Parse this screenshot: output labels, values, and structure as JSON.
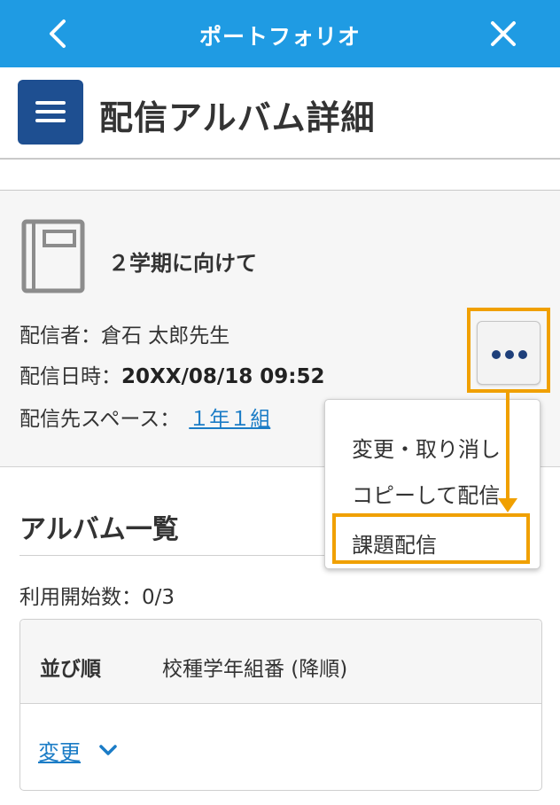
{
  "topbar": {
    "title": "ポートフォリオ",
    "back_icon": "chevron-left-icon",
    "close_icon": "close-icon",
    "color": "#1f9be3"
  },
  "header": {
    "menu_icon": "hamburger-menu-icon",
    "title": "配信アルバム詳細",
    "menu_color": "#1e4f91"
  },
  "album": {
    "icon": "book-icon",
    "title": "２学期に向けて",
    "sender_label": "配信者：",
    "sender_value": "倉石 太郎先生",
    "date_label": "配信日時：",
    "date_value": "20XX/08/18 09:52",
    "space_label": "配信先スペース：",
    "space_value": "１年１組"
  },
  "more_menu": {
    "button_icon": "more-dots-icon",
    "items": [
      "変更・取り消し",
      "コピーして配信",
      "課題配信"
    ],
    "highlighted_item": "課題配信",
    "highlight_color": "#f0a000"
  },
  "album_list": {
    "title": "アルバム一覧",
    "start_count_label": "利用開始数：",
    "start_count_value": "0/3",
    "sort_label": "並び順",
    "sort_value": "校種学年組番 (降順)",
    "change_label": "変更",
    "change_icon": "chevron-down-icon",
    "link_color": "#1b7cc6"
  }
}
